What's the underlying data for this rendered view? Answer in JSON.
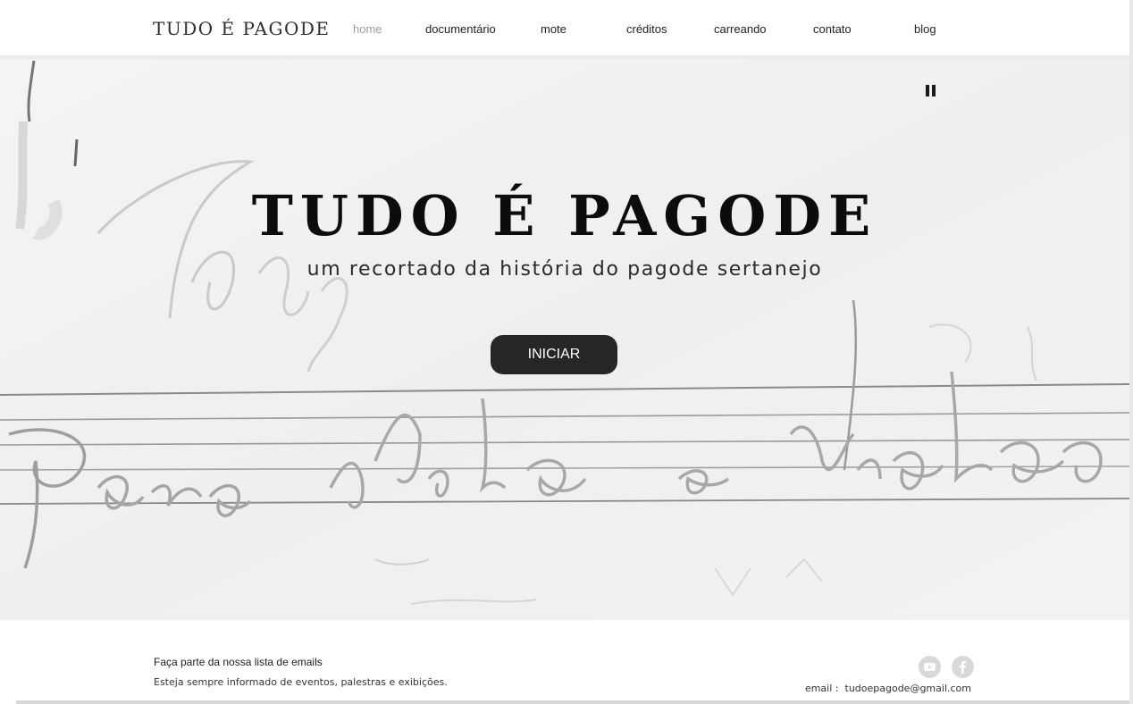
{
  "header": {
    "site_title": "TUDO É PAGODE",
    "nav": [
      {
        "label": "home",
        "active": true
      },
      {
        "label": "documentário"
      },
      {
        "label": "mote"
      },
      {
        "label": "créditos"
      },
      {
        "label": "carreando"
      },
      {
        "label": "contato"
      },
      {
        "label": "blog"
      }
    ]
  },
  "hero": {
    "title": "TUDO É PAGODE",
    "subtitle": "um recortado da história do pagode sertanejo",
    "button_label": "INICIAR",
    "pause_icon": "pause-icon"
  },
  "footer": {
    "newsletter_title": "Faça parte da nossa lista de emails",
    "newsletter_subtitle": "Esteja sempre informado de eventos, palestras e exibições.",
    "email_label": "email :",
    "email_address": "tudoepagode@gmail.com",
    "social": [
      {
        "icon": "youtube-icon"
      },
      {
        "icon": "facebook-icon"
      }
    ]
  },
  "colors": {
    "text_dark": "#0c0c0c",
    "button_bg": "#262626",
    "nav_active": "#9c9c9c",
    "social_gray": "#d9d9d9"
  }
}
